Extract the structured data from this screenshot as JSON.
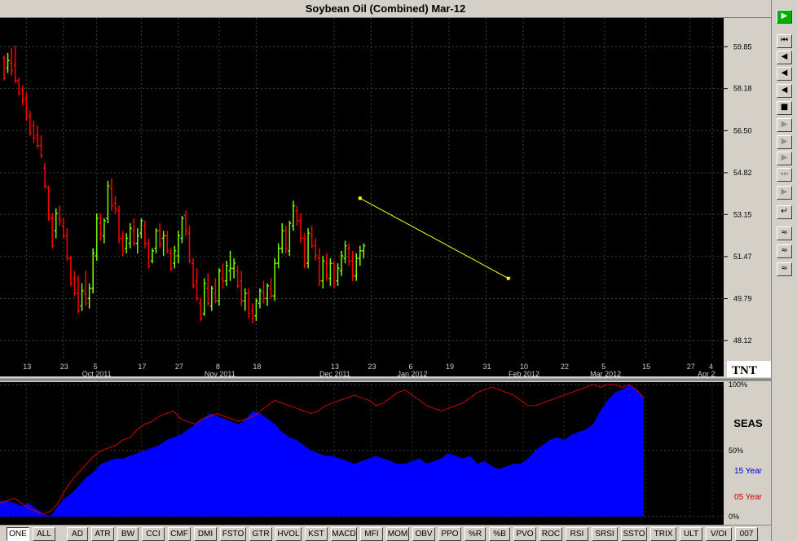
{
  "window": {
    "title": "Soybean Oil (Combined) Mar-12"
  },
  "price_axis": {
    "labels": [
      "59.85",
      "58.18",
      "56.50",
      "54.82",
      "53.15",
      "51.47",
      "49.79",
      "48.12"
    ]
  },
  "date_axis": {
    "days": [
      "13",
      "23",
      "5",
      "17",
      "27",
      "8",
      "18",
      "13",
      "23",
      "6",
      "19",
      "31",
      "10",
      "22",
      "5",
      "15",
      "27",
      "4"
    ],
    "months": [
      "Oct 2011",
      "Nov 2011",
      "Dec 2011",
      "Jan 2012",
      "Feb 2012",
      "Mar 2012",
      "Apr 2"
    ]
  },
  "logo": "TNT",
  "seasonal": {
    "title": "SEAS",
    "pct_labels": [
      "100%",
      "50%",
      "0%"
    ],
    "legend": [
      {
        "label": "15 Year",
        "color": "#0000cc"
      },
      {
        "label": "05 Year",
        "color": "#cc0000"
      }
    ]
  },
  "tabs": [
    "ONE",
    "ALL",
    "AD",
    "ATR",
    "BW",
    "CCI",
    "CMF",
    "DMI",
    "FSTO",
    "GTR",
    "HVOL",
    "KST",
    "MACD",
    "MFI",
    "MOM",
    "OBV",
    "PPO",
    "%R",
    "%B",
    "PVO",
    "ROC",
    "RSI",
    "SRSI",
    "SSTO",
    "TRIX",
    "ULT",
    "V/OI",
    "007"
  ],
  "active_tab": "ONE",
  "toolbar_icons": [
    "play-icon",
    "first-icon",
    "rewind-icon",
    "step-back-icon",
    "fast-back-icon",
    "stop-icon",
    "step-fwd-icon",
    "fast-fwd-icon",
    "forward-icon",
    "last-icon",
    "ff-icon",
    "redraw-icon",
    "wave-icon",
    "wave2-icon",
    "wave3-icon"
  ],
  "colors": {
    "up_bar": "#7cfc00",
    "down_bar": "#ff0000",
    "trendline": "#ffff00",
    "seasonal15": "#0000ff",
    "seasonal05": "#cc0000"
  },
  "chart_data": {
    "type": "bar",
    "title": "Soybean Oil (Combined) Mar-12",
    "ylim": [
      47.4,
      61.0
    ],
    "ohlc": [
      [
        59.4,
        59.5,
        58.5,
        58.6
      ],
      [
        59.0,
        59.6,
        58.8,
        59.3
      ],
      [
        59.2,
        59.8,
        58.7,
        58.9
      ],
      [
        59.1,
        59.9,
        58.4,
        58.5
      ],
      [
        58.5,
        58.6,
        57.9,
        58.0
      ],
      [
        58.1,
        58.3,
        57.5,
        57.7
      ],
      [
        57.8,
        58.0,
        56.9,
        57.0
      ],
      [
        57.1,
        57.3,
        56.3,
        56.4
      ],
      [
        56.7,
        56.9,
        56.0,
        56.2
      ],
      [
        56.3,
        56.7,
        55.8,
        55.9
      ],
      [
        55.9,
        56.3,
        55.4,
        55.5
      ],
      [
        55.0,
        55.2,
        54.2,
        54.3
      ],
      [
        54.2,
        54.3,
        52.9,
        53.0
      ],
      [
        53.0,
        53.2,
        51.8,
        51.9
      ],
      [
        52.5,
        53.4,
        52.2,
        53.2
      ],
      [
        53.0,
        53.5,
        52.7,
        52.9
      ],
      [
        52.7,
        53.0,
        52.2,
        52.3
      ],
      [
        52.3,
        52.6,
        51.3,
        51.4
      ],
      [
        51.4,
        51.5,
        50.3,
        50.4
      ],
      [
        50.6,
        50.9,
        49.9,
        50.0
      ],
      [
        50.0,
        50.7,
        49.2,
        49.3
      ],
      [
        49.5,
        50.4,
        49.3,
        50.1
      ],
      [
        50.0,
        50.9,
        49.5,
        49.6
      ],
      [
        49.8,
        50.4,
        49.4,
        50.2
      ],
      [
        50.2,
        51.8,
        50.0,
        51.6
      ],
      [
        51.5,
        53.2,
        51.3,
        53.0
      ],
      [
        52.8,
        53.2,
        52.1,
        52.4
      ],
      [
        52.3,
        53.0,
        52.0,
        52.9
      ],
      [
        53.0,
        54.5,
        52.8,
        54.3
      ],
      [
        54.2,
        54.6,
        53.3,
        53.5
      ],
      [
        53.6,
        53.9,
        53.2,
        53.4
      ],
      [
        53.3,
        53.5,
        52.0,
        52.2
      ],
      [
        52.2,
        52.5,
        51.5,
        51.7
      ],
      [
        51.8,
        52.4,
        51.6,
        52.2
      ],
      [
        52.0,
        52.8,
        51.8,
        52.6
      ],
      [
        52.5,
        53.0,
        51.9,
        52.0
      ],
      [
        52.0,
        52.6,
        51.6,
        52.3
      ],
      [
        52.4,
        53.0,
        52.2,
        52.9
      ],
      [
        52.7,
        52.9,
        51.8,
        52.0
      ],
      [
        52.0,
        52.2,
        51.0,
        51.1
      ],
      [
        51.3,
        51.8,
        51.2,
        51.7
      ],
      [
        51.8,
        52.6,
        51.6,
        52.5
      ],
      [
        52.5,
        52.8,
        51.8,
        52.0
      ],
      [
        52.2,
        52.5,
        51.5,
        52.3
      ],
      [
        52.3,
        52.5,
        51.6,
        51.7
      ],
      [
        51.6,
        51.8,
        50.9,
        51.0
      ],
      [
        51.2,
        51.9,
        51.0,
        51.7
      ],
      [
        51.5,
        52.5,
        51.2,
        52.3
      ],
      [
        52.2,
        53.1,
        52.0,
        53.0
      ],
      [
        53.1,
        53.3,
        52.3,
        52.5
      ],
      [
        52.4,
        52.7,
        51.2,
        51.3
      ],
      [
        51.2,
        51.4,
        50.2,
        50.3
      ],
      [
        50.5,
        51.0,
        49.7,
        49.8
      ],
      [
        49.6,
        49.8,
        48.9,
        49.0
      ],
      [
        49.2,
        50.6,
        49.1,
        50.4
      ],
      [
        50.2,
        50.8,
        49.5,
        49.6
      ],
      [
        49.5,
        50.3,
        49.3,
        50.2
      ],
      [
        50.0,
        50.6,
        49.6,
        49.7
      ],
      [
        49.7,
        51.0,
        49.5,
        50.9
      ],
      [
        50.6,
        51.2,
        50.2,
        50.5
      ],
      [
        50.5,
        51.3,
        50.3,
        51.1
      ],
      [
        50.9,
        51.7,
        50.5,
        51.0
      ],
      [
        51.0,
        51.4,
        50.6,
        51.2
      ],
      [
        50.9,
        51.1,
        50.2,
        50.3
      ],
      [
        50.5,
        50.9,
        49.5,
        49.7
      ],
      [
        49.7,
        50.2,
        49.3,
        50.0
      ],
      [
        50.0,
        50.2,
        49.0,
        49.2
      ],
      [
        49.3,
        49.6,
        48.8,
        49.0
      ],
      [
        49.1,
        49.8,
        48.9,
        49.7
      ],
      [
        49.6,
        50.2,
        49.4,
        50.1
      ],
      [
        50.0,
        50.5,
        49.6,
        49.8
      ],
      [
        49.8,
        50.4,
        49.5,
        50.3
      ],
      [
        50.2,
        50.6,
        49.8,
        49.9
      ],
      [
        49.9,
        51.4,
        49.7,
        51.2
      ],
      [
        51.2,
        52.0,
        51.0,
        51.8
      ],
      [
        51.8,
        52.8,
        51.6,
        52.5
      ],
      [
        52.5,
        52.7,
        51.6,
        51.8
      ],
      [
        51.7,
        52.9,
        51.5,
        52.8
      ],
      [
        52.7,
        53.7,
        52.5,
        53.5
      ],
      [
        53.3,
        53.5,
        52.7,
        52.9
      ],
      [
        52.9,
        53.2,
        52.0,
        52.2
      ],
      [
        52.2,
        52.4,
        51.0,
        51.1
      ],
      [
        51.2,
        52.6,
        51.0,
        52.4
      ],
      [
        52.3,
        52.7,
        51.8,
        51.9
      ],
      [
        51.9,
        52.2,
        51.3,
        51.5
      ],
      [
        51.4,
        51.8,
        50.3,
        50.5
      ],
      [
        50.5,
        51.5,
        50.2,
        51.3
      ],
      [
        51.2,
        51.6,
        50.5,
        50.7
      ],
      [
        50.6,
        51.4,
        50.3,
        51.2
      ],
      [
        51.2,
        51.3,
        50.2,
        50.4
      ],
      [
        50.5,
        51.2,
        50.3,
        51.0
      ],
      [
        50.9,
        51.7,
        50.7,
        51.5
      ],
      [
        51.4,
        52.1,
        51.2,
        51.9
      ],
      [
        51.8,
        52.0,
        51.1,
        51.3
      ],
      [
        51.3,
        51.7,
        50.5,
        50.7
      ],
      [
        50.7,
        51.6,
        50.5,
        51.4
      ],
      [
        51.4,
        51.9,
        51.1,
        51.7
      ],
      [
        51.7,
        52.0,
        51.4,
        51.9
      ]
    ],
    "trendline": {
      "from": [
        96,
        53.8
      ],
      "to": [
        136,
        50.6
      ]
    },
    "seasonal_15yr_pct": [
      12,
      12,
      10,
      8,
      10,
      6,
      2,
      0,
      8,
      14,
      18,
      24,
      30,
      34,
      40,
      42,
      44,
      44,
      46,
      48,
      50,
      52,
      54,
      58,
      60,
      62,
      66,
      70,
      74,
      78,
      76,
      74,
      72,
      70,
      74,
      80,
      78,
      74,
      70,
      64,
      60,
      58,
      54,
      50,
      48,
      46,
      46,
      44,
      42,
      40,
      42,
      44,
      46,
      44,
      42,
      40,
      40,
      42,
      44,
      40,
      42,
      44,
      48,
      46,
      44,
      46,
      40,
      42,
      38,
      36,
      38,
      40,
      40,
      44,
      50,
      54,
      58,
      60,
      58,
      62,
      64,
      66,
      70,
      80,
      88,
      94,
      96,
      100,
      96,
      90
    ],
    "seasonal_05yr_pct": [
      10,
      12,
      14,
      10,
      6,
      4,
      2,
      4,
      10,
      20,
      28,
      34,
      40,
      46,
      50,
      52,
      54,
      58,
      60,
      66,
      70,
      72,
      76,
      78,
      80,
      74,
      72,
      70,
      74,
      76,
      78,
      76,
      74,
      72,
      74,
      76,
      80,
      84,
      88,
      86,
      84,
      82,
      80,
      78,
      80,
      84,
      86,
      88,
      90,
      92,
      90,
      88,
      84,
      86,
      90,
      94,
      96,
      92,
      88,
      84,
      82,
      80,
      82,
      84,
      86,
      90,
      94,
      96,
      98,
      96,
      94,
      92,
      88,
      84,
      84,
      86,
      88,
      90,
      92,
      94,
      96,
      98,
      100,
      98,
      100,
      100,
      98,
      100,
      96,
      90
    ]
  }
}
